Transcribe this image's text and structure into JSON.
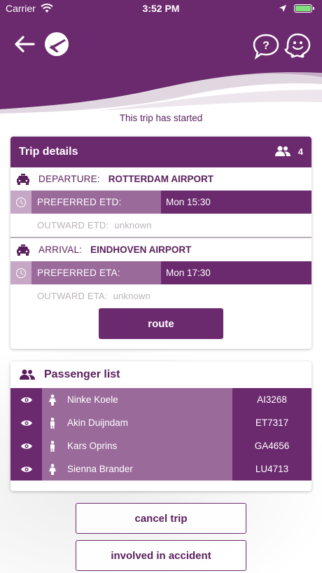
{
  "status_bar": {
    "carrier": "Carrier",
    "time": "3:52 PM"
  },
  "header": {
    "back_icon": "arrow-left-icon",
    "logo_icon": "plane-logo-icon",
    "help_icon": "question-bubble-icon",
    "waze_icon": "waze-icon"
  },
  "trip_status": "This trip has started",
  "trip_details": {
    "title": "Trip details",
    "passenger_count": "4",
    "departure": {
      "label": "DEPARTURE:",
      "value": "ROTTERDAM AIRPORT",
      "preferred_label": "PREFERRED ETD:",
      "preferred_value": "Mon 15:30",
      "outward_label": "OUTWARD ETD:",
      "outward_value": "unknown"
    },
    "arrival": {
      "label": "ARRIVAL:",
      "value": "EINDHOVEN AIRPORT",
      "preferred_label": "PREFERRED ETA:",
      "preferred_value": "Mon 17:30",
      "outward_label": "OUTWARD ETA:",
      "outward_value": "unknown"
    },
    "route_label": "route"
  },
  "passenger_list": {
    "title": "Passenger list",
    "passengers": [
      {
        "name": "Ninke Koele",
        "code": "AI3268",
        "gender": "female"
      },
      {
        "name": "Akin Duijndam",
        "code": "ET7317",
        "gender": "male"
      },
      {
        "name": "Kars Oprins",
        "code": "GA4656",
        "gender": "male"
      },
      {
        "name": "Sienna Brander",
        "code": "LU4713",
        "gender": "female"
      }
    ]
  },
  "actions": {
    "cancel_label": "cancel trip",
    "accident_label": "involved in accident"
  },
  "colors": {
    "primary": "#6b2a6e",
    "secondary": "#9a6a9b",
    "light": "#c7a7c6"
  }
}
